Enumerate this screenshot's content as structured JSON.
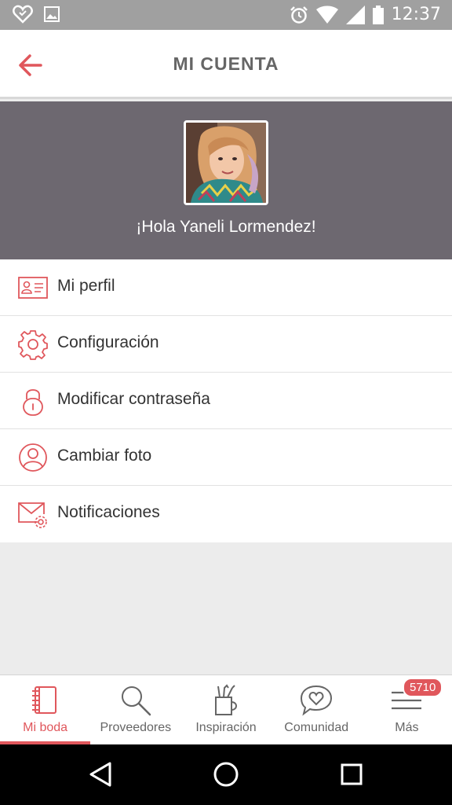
{
  "status_bar": {
    "time": "12:37",
    "icons": [
      "heart-outline-icon",
      "image-icon",
      "alarm-icon",
      "wifi-icon",
      "signal-icon",
      "battery-icon"
    ]
  },
  "header": {
    "title": "MI CUENTA",
    "back_icon": "arrow-left-icon"
  },
  "profile": {
    "greeting": "¡Hola Yaneli Lormendez!",
    "background_color": "#6d6870"
  },
  "menu": {
    "items": [
      {
        "label": "Mi perfil",
        "icon": "id-card-icon"
      },
      {
        "label": "Configuración",
        "icon": "gear-icon"
      },
      {
        "label": "Modificar contraseña",
        "icon": "lock-icon"
      },
      {
        "label": "Cambiar foto",
        "icon": "user-circle-icon"
      },
      {
        "label": "Notificaciones",
        "icon": "mail-settings-icon"
      }
    ]
  },
  "bottom_nav": {
    "tabs": [
      {
        "label": "Mi boda",
        "icon": "notebook-icon",
        "active": true
      },
      {
        "label": "Proveedores",
        "icon": "search-icon",
        "active": false
      },
      {
        "label": "Inspiración",
        "icon": "pencil-cup-icon",
        "active": false
      },
      {
        "label": "Comunidad",
        "icon": "chat-heart-icon",
        "active": false
      },
      {
        "label": "Más",
        "icon": "menu-icon",
        "active": false
      }
    ],
    "badge": "5710"
  },
  "colors": {
    "accent": "#e0575c",
    "icon_gray": "#666666"
  }
}
